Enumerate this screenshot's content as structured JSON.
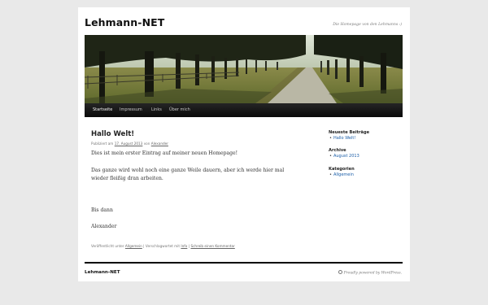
{
  "site": {
    "title": "Lehmann-NET",
    "description": "Die Homepage von den Lehmanns :)"
  },
  "nav": {
    "items": [
      "Startseite",
      "Impressum",
      "Links",
      "Über mich"
    ]
  },
  "post": {
    "title": "Hallo Welt!",
    "meta_prefix": "Publiziert am",
    "date": "17. August 2013",
    "meta_by": "von",
    "author": "Alexander",
    "paragraphs": [
      "Dies ist mein erster Eintrag auf meiner neuen Homepage!",
      "Das ganze wird wohl noch eine ganze Weile dauern, aber ich werde hier mal",
      "wieder fleißig dran arbeiten.",
      "Bis dann",
      "Alexander"
    ],
    "footer_prefix": "Veröffentlicht unter",
    "category": "Allgemein",
    "footer_tag_prefix": "| Verschlagwortet mit",
    "tag": "Info",
    "footer_sep": "|",
    "comment_link": "Schreib einen Kommentar"
  },
  "sidebar": {
    "widgets": [
      {
        "title": "Neueste Beiträge",
        "items": [
          "Hallo Welt!"
        ]
      },
      {
        "title": "Archive",
        "items": [
          "August 2013"
        ]
      },
      {
        "title": "Kategorien",
        "items": [
          "Allgemein"
        ]
      }
    ]
  },
  "footer": {
    "title": "Lehmann-NET",
    "powered": "Proudly powered by WordPress."
  },
  "colors": {
    "background": "#e9e9e9",
    "link": "#1b5ea8",
    "nav_bg": "#111111"
  },
  "icons": [
    "wordpress-icon"
  ]
}
